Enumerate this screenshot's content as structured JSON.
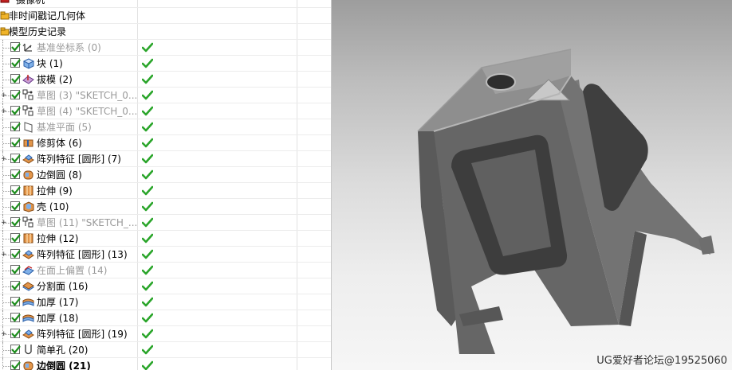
{
  "tree": {
    "top_partial_label": "摄像机",
    "headers": [
      {
        "label": "非时间戳记几何体"
      },
      {
        "label": "模型历史记录"
      }
    ],
    "features": [
      {
        "label": "基准坐标系 (0)",
        "style": "grey",
        "icon": "datum-csys-icon",
        "expand": false,
        "ok": true
      },
      {
        "label": "块 (1)",
        "style": "normal",
        "icon": "block-icon",
        "expand": false,
        "ok": true
      },
      {
        "label": "拔模 (2)",
        "style": "normal",
        "icon": "draft-icon",
        "expand": false,
        "ok": true
      },
      {
        "label": "草图 (3) \"SKETCH_0...",
        "style": "grey",
        "icon": "sketch-icon",
        "expand": true,
        "ok": true
      },
      {
        "label": "草图 (4) \"SKETCH_0...",
        "style": "grey",
        "icon": "sketch-icon",
        "expand": true,
        "ok": true
      },
      {
        "label": "基准平面 (5)",
        "style": "grey",
        "icon": "datum-plane-icon",
        "expand": false,
        "ok": true
      },
      {
        "label": "修剪体 (6)",
        "style": "normal",
        "icon": "trim-body-icon",
        "expand": false,
        "ok": true
      },
      {
        "label": "阵列特征 [圆形] (7)",
        "style": "normal",
        "icon": "pattern-icon",
        "expand": true,
        "ok": true
      },
      {
        "label": "边倒圆 (8)",
        "style": "normal",
        "icon": "edge-blend-icon",
        "expand": false,
        "ok": true
      },
      {
        "label": "拉伸 (9)",
        "style": "normal",
        "icon": "extrude-icon",
        "expand": false,
        "ok": true
      },
      {
        "label": "壳 (10)",
        "style": "normal",
        "icon": "shell-icon",
        "expand": false,
        "ok": true
      },
      {
        "label": "草图 (11) \"SKETCH_...",
        "style": "grey",
        "icon": "sketch-icon",
        "expand": true,
        "ok": true
      },
      {
        "label": "拉伸 (12)",
        "style": "normal",
        "icon": "extrude-icon",
        "expand": false,
        "ok": true
      },
      {
        "label": "阵列特征 [圆形] (13)",
        "style": "normal",
        "icon": "pattern-icon",
        "expand": true,
        "ok": true
      },
      {
        "label": "在面上偏置 (14)",
        "style": "grey",
        "icon": "offset-face-icon",
        "expand": false,
        "ok": true
      },
      {
        "label": "分割面 (16)",
        "style": "normal",
        "icon": "divide-face-icon",
        "expand": false,
        "ok": true
      },
      {
        "label": "加厚 (17)",
        "style": "normal",
        "icon": "thicken-icon",
        "expand": false,
        "ok": true
      },
      {
        "label": "加厚 (18)",
        "style": "normal",
        "icon": "thicken-icon",
        "expand": false,
        "ok": true
      },
      {
        "label": "阵列特征 [圆形] (19)",
        "style": "normal",
        "icon": "pattern-icon",
        "expand": true,
        "ok": true
      },
      {
        "label": "简单孔 (20)",
        "style": "normal",
        "icon": "hole-icon",
        "expand": false,
        "ok": true
      },
      {
        "label": "边倒圆 (21)",
        "style": "bold",
        "icon": "edge-blend-icon",
        "expand": false,
        "ok": true
      }
    ]
  },
  "viewport": {
    "model": "plastic-stool-model",
    "watermark": "UG爱好者论坛@19525060"
  },
  "colors": {
    "ok_green": "#2aa52a",
    "check_green": "#1e8e1e",
    "model_dark": "#5c5c5c",
    "model_light": "#8a8a8a"
  }
}
